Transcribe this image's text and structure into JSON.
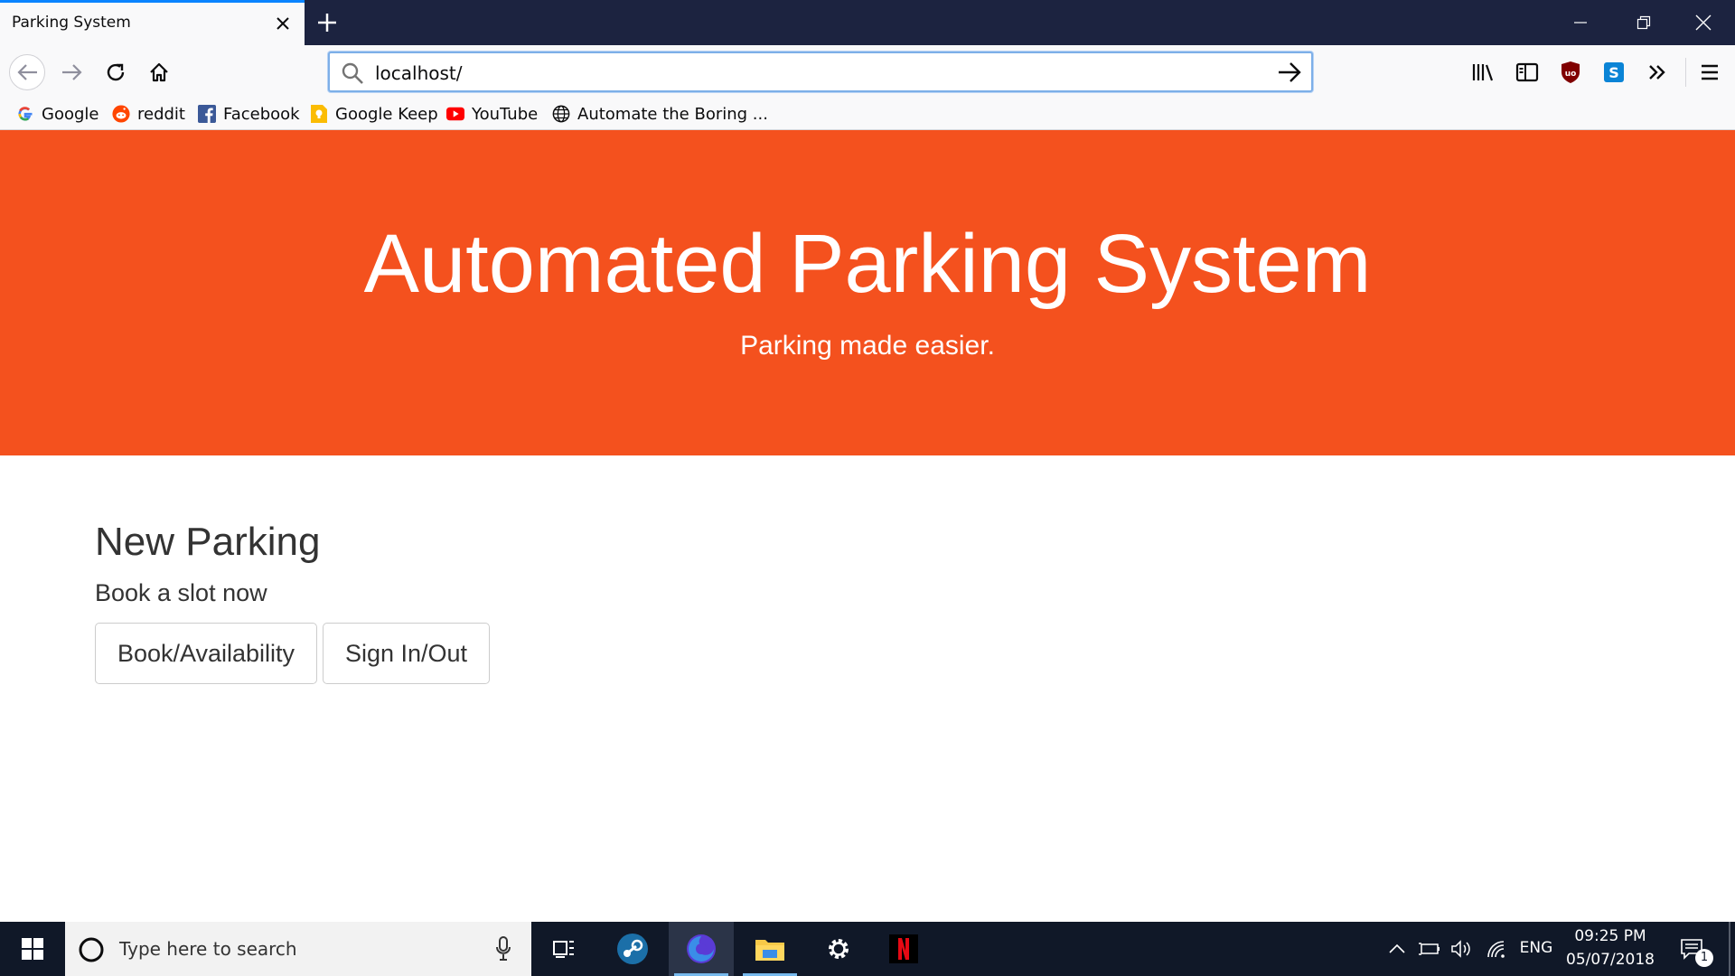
{
  "browser": {
    "tab_title": "Parking System",
    "url": "localhost/",
    "bookmarks": [
      {
        "label": "Google",
        "icon": "google-icon"
      },
      {
        "label": "reddit",
        "icon": "reddit-icon"
      },
      {
        "label": "Facebook",
        "icon": "facebook-icon"
      },
      {
        "label": "Google Keep",
        "icon": "google-keep-icon"
      },
      {
        "label": "YouTube",
        "icon": "youtube-icon"
      },
      {
        "label": "Automate the Boring ...",
        "icon": "globe-icon"
      }
    ],
    "accent_color": "#0a84ff"
  },
  "page": {
    "hero": {
      "title": "Automated Parking System",
      "subtitle": "Parking made easier.",
      "background_color": "#f4511e"
    },
    "section": {
      "title": "New Parking",
      "subtitle": "Book a slot now",
      "buttons": [
        "Book/Availability",
        "Sign In/Out"
      ]
    }
  },
  "taskbar": {
    "search_placeholder": "Type here to search",
    "language": "ENG",
    "time": "09:25 PM",
    "date": "05/07/2018",
    "notification_count": "1",
    "apps": [
      "task-view-icon",
      "steam-icon",
      "firefox-icon",
      "file-explorer-icon",
      "settings-icon",
      "netflix-icon"
    ]
  }
}
